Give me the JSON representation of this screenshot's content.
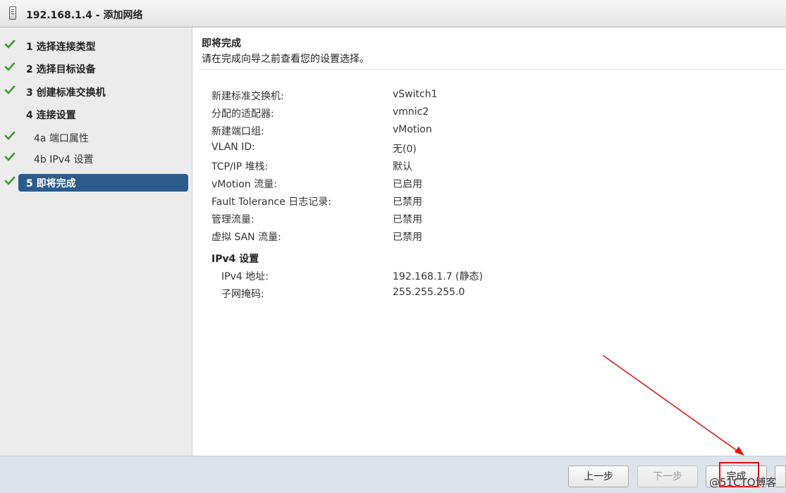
{
  "window": {
    "title": "192.168.1.4 - 添加网络"
  },
  "sidebar": {
    "steps": [
      {
        "label": "1  选择连接类型",
        "done": true
      },
      {
        "label": "2  选择目标设备",
        "done": true
      },
      {
        "label": "3  创建标准交换机",
        "done": true
      },
      {
        "label": "4  连接设置",
        "done": false
      },
      {
        "label": "4a  端口属性",
        "done": true
      },
      {
        "label": "4b  IPv4 设置",
        "done": true
      },
      {
        "label": "5  即将完成",
        "done": true,
        "active": true
      }
    ]
  },
  "main": {
    "heading": "即将完成",
    "subheading": "请在完成向导之前查看您的设置选择。",
    "settings": [
      {
        "key": "新建标准交换机:",
        "value": "vSwitch1"
      },
      {
        "key": "分配的适配器:",
        "value": "vmnic2"
      },
      {
        "key": "新建端口组:",
        "value": "vMotion"
      },
      {
        "key": "VLAN ID:",
        "value": "无(0)"
      },
      {
        "key": "TCP/IP 堆栈:",
        "value": "默认"
      },
      {
        "key": "vMotion 流量:",
        "value": "已启用"
      },
      {
        "key": "Fault Tolerance 日志记录:",
        "value": "已禁用"
      },
      {
        "key": "管理流量:",
        "value": "已禁用"
      },
      {
        "key": "虚拟 SAN 流量:",
        "value": "已禁用"
      }
    ],
    "ipv4": {
      "title": "IPv4 设置",
      "rows": [
        {
          "key": "IPv4 地址:",
          "value": "192.168.1.7 (静态)"
        },
        {
          "key": "子网掩码:",
          "value": "255.255.255.0"
        }
      ]
    }
  },
  "footer": {
    "back_label": "上一步",
    "next_label": "下一步",
    "finish_label": "完成"
  },
  "watermark": "@51CTO博客",
  "colors": {
    "accent": "#2c5a8a",
    "check": "#3a9a2a",
    "annotation": "#e01010"
  }
}
